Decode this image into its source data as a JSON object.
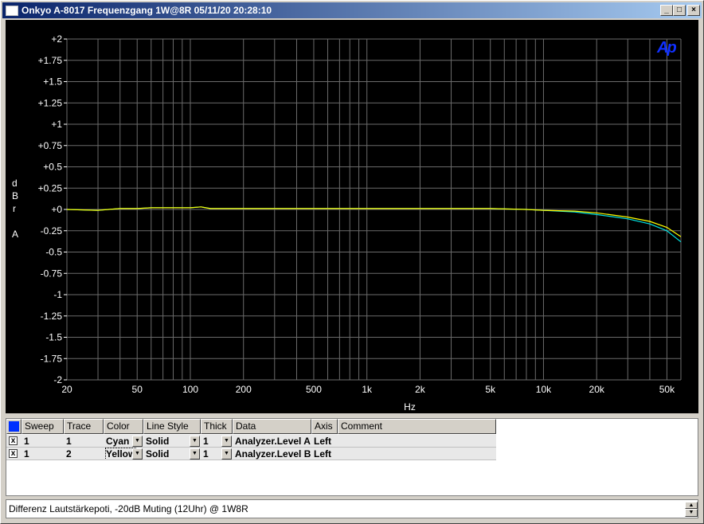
{
  "window": {
    "title": "Onkyo A-8017 Frequenzgang 1W@8R  05/11/20 20:28:10",
    "controls": [
      "minimize-icon",
      "maximize-icon",
      "close-icon"
    ]
  },
  "graph": {
    "logo": "Ap",
    "y_axis_label_lines": [
      "d",
      "B",
      "r",
      "",
      "A"
    ],
    "x_axis_label": "Hz",
    "background": "#000000",
    "grid_color": "#6b6b6b"
  },
  "chart_data": {
    "type": "line",
    "title": "Onkyo A-8017 Frequenzgang 1W@8R  05/11/20 20:28:10",
    "xlabel": "Hz",
    "ylabel": "dBr A",
    "x_scale": "log",
    "xlim": [
      20,
      60000
    ],
    "ylim": [
      -2,
      2
    ],
    "grid": true,
    "x_ticks": [
      {
        "value": 20,
        "label": "20"
      },
      {
        "value": 50,
        "label": "50"
      },
      {
        "value": 100,
        "label": "100"
      },
      {
        "value": 200,
        "label": "200"
      },
      {
        "value": 500,
        "label": "500"
      },
      {
        "value": 1000,
        "label": "1k"
      },
      {
        "value": 2000,
        "label": "2k"
      },
      {
        "value": 5000,
        "label": "5k"
      },
      {
        "value": 10000,
        "label": "10k"
      },
      {
        "value": 20000,
        "label": "20k"
      },
      {
        "value": 50000,
        "label": "50k"
      }
    ],
    "y_ticks": [
      {
        "value": 2,
        "label": "+2"
      },
      {
        "value": 1.75,
        "label": "+1.75"
      },
      {
        "value": 1.5,
        "label": "+1.5"
      },
      {
        "value": 1.25,
        "label": "+1.25"
      },
      {
        "value": 1,
        "label": "+1"
      },
      {
        "value": 0.75,
        "label": "+0.75"
      },
      {
        "value": 0.5,
        "label": "+0.5"
      },
      {
        "value": 0.25,
        "label": "+0.25"
      },
      {
        "value": 0,
        "label": "+0"
      },
      {
        "value": -0.25,
        "label": "-0.25"
      },
      {
        "value": -0.5,
        "label": "-0.5"
      },
      {
        "value": -0.75,
        "label": "-0.75"
      },
      {
        "value": -1,
        "label": "-1"
      },
      {
        "value": -1.25,
        "label": "-1.25"
      },
      {
        "value": -1.5,
        "label": "-1.5"
      },
      {
        "value": -1.75,
        "label": "-1.75"
      },
      {
        "value": -2,
        "label": "-2"
      }
    ],
    "series": [
      {
        "color": "#00e5e5",
        "x": [
          20,
          30,
          40,
          50,
          60,
          80,
          100,
          115,
          130,
          200,
          500,
          1000,
          2000,
          5000,
          8000,
          10000,
          15000,
          20000,
          30000,
          40000,
          50000,
          60000
        ],
        "y": [
          0.0,
          -0.01,
          0.01,
          0.01,
          0.02,
          0.02,
          0.02,
          0.03,
          0.01,
          0.01,
          0.01,
          0.01,
          0.01,
          0.01,
          0.0,
          -0.01,
          -0.03,
          -0.06,
          -0.11,
          -0.17,
          -0.25,
          -0.38
        ]
      },
      {
        "color": "#ffff00",
        "x": [
          20,
          30,
          40,
          50,
          60,
          80,
          100,
          115,
          130,
          200,
          500,
          1000,
          2000,
          5000,
          8000,
          10000,
          15000,
          20000,
          30000,
          40000,
          50000,
          60000
        ],
        "y": [
          0.0,
          -0.01,
          0.01,
          0.01,
          0.02,
          0.02,
          0.02,
          0.03,
          0.01,
          0.01,
          0.01,
          0.01,
          0.01,
          0.01,
          0.0,
          -0.01,
          -0.02,
          -0.04,
          -0.09,
          -0.14,
          -0.21,
          -0.32
        ]
      }
    ]
  },
  "table": {
    "columns": [
      "Sweep",
      "Trace",
      "Color",
      "Line Style",
      "Thick",
      "Data",
      "Axis",
      "Comment"
    ],
    "rows": [
      {
        "checked": "x",
        "sweep": "1",
        "trace": "1",
        "color": "Cyan",
        "line_style": "Solid",
        "thick": "1",
        "data": "Analyzer.Level A",
        "axis": "Left",
        "comment": ""
      },
      {
        "checked": "x",
        "sweep": "1",
        "trace": "2",
        "color": "Yellow",
        "line_style": "Solid",
        "thick": "1",
        "data": "Analyzer.Level B",
        "axis": "Left",
        "comment": ""
      }
    ]
  },
  "comment_bar": {
    "text": "Differenz Lautstärkepoti, -20dB Muting (12Uhr) @ 1W8R"
  }
}
